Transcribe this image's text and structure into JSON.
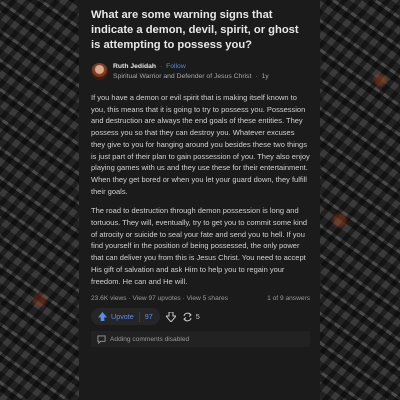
{
  "question": {
    "title": "What are some warning signs that indicate a demon, devil, spirit, or ghost is attempting to possess you?"
  },
  "author": {
    "name": "Ruth Jedidah",
    "follow_label": "Follow",
    "credential": "Spiritual Warrior and Defender of Jesus Christ",
    "age": "1y"
  },
  "answer": {
    "paragraphs": [
      "If you have a demon or evil spirit that is making itself known to you, this means that it is going to try to possess you. Possession and destruction are always the end goals of these entities. They possess you so that they can destroy you. Whatever excuses they give to you for hanging around you besides these two things is just part of their plan to gain possession of you. They also enjoy playing games with us and they use these for their entertainment. When they get bored or when you let your guard down, they fulfill their goals.",
      "The road to destruction through demon possession is long and tortuous. They will, eventually, try to get you to commit some kind of atrocity or suicide to seal your fate and send you to hell. If you find yourself in the position of being possessed, the only power that can deliver you from this is Jesus Christ. You need to accept His gift of salvation and ask Him to help you to regain your freedom. He can and He will."
    ]
  },
  "stats": {
    "views": "23.6K views",
    "upvotes": "View 97 upvotes",
    "shares": "View 5 shares",
    "answers": "1 of 9 answers"
  },
  "actions": {
    "upvote_label": "Upvote",
    "upvote_count": "97",
    "share_count": "5",
    "comments_disabled": "Adding comments disabled"
  },
  "colors": {
    "card_bg": "#1b1b1b",
    "accent_blue": "#4d8ee0"
  }
}
